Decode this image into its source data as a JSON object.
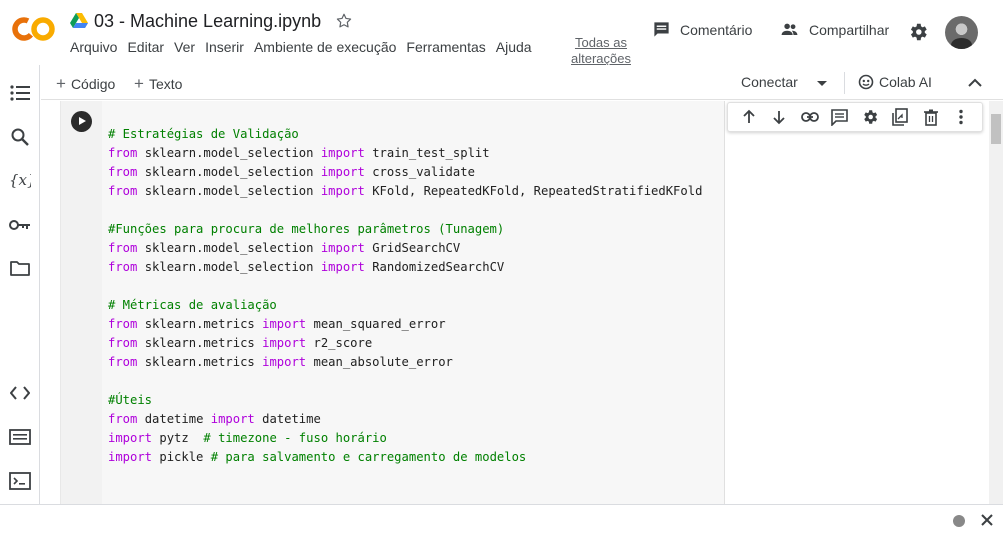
{
  "header": {
    "title": "03 - Machine Learning.ipynb",
    "menu": [
      "Arquivo",
      "Editar",
      "Ver",
      "Inserir",
      "Ambiente de execução",
      "Ferramentas",
      "Ajuda"
    ],
    "all_changes": "Todas as alterações",
    "comment_label": "Comentário",
    "share_label": "Compartilhar"
  },
  "toolbar": {
    "add_code": "Código",
    "add_text": "Texto",
    "connect": "Conectar",
    "colab_ai": "Colab AI"
  },
  "cell": {
    "lines": [
      "# Estratégias de Validação",
      "from sklearn.model_selection import train_test_split",
      "from sklearn.model_selection import cross_validate",
      "from sklearn.model_selection import KFold, RepeatedKFold, RepeatedStratifiedKFold",
      "",
      "#Funções para procura de melhores parâmetros (Tunagem)",
      "from sklearn.model_selection import GridSearchCV",
      "from sklearn.model_selection import RandomizedSearchCV",
      "",
      "# Métricas de avaliação",
      "from sklearn.metrics import mean_squared_error",
      "from sklearn.metrics import r2_score",
      "from sklearn.metrics import mean_absolute_error",
      "",
      "#Úteis",
      "from datetime import datetime",
      "import pytz  # timezone - fuso horário",
      "import pickle # para salvamento e carregamento de modelos"
    ]
  },
  "icons": {
    "rail": [
      "toc-icon",
      "search-icon",
      "variables-icon",
      "key-icon",
      "folder-icon",
      "code-snippets-icon",
      "command-palette-icon",
      "terminal-icon"
    ],
    "cell_toolbar": [
      "move-up-icon",
      "move-down-icon",
      "link-icon",
      "comment-icon",
      "settings-icon",
      "mirror-cell-icon",
      "delete-icon",
      "more-icon"
    ]
  },
  "colors": {
    "keyword": "#af00db",
    "comment": "#008000",
    "logo_orange": "#f9ab00",
    "logo_dark_orange": "#e8710a"
  }
}
